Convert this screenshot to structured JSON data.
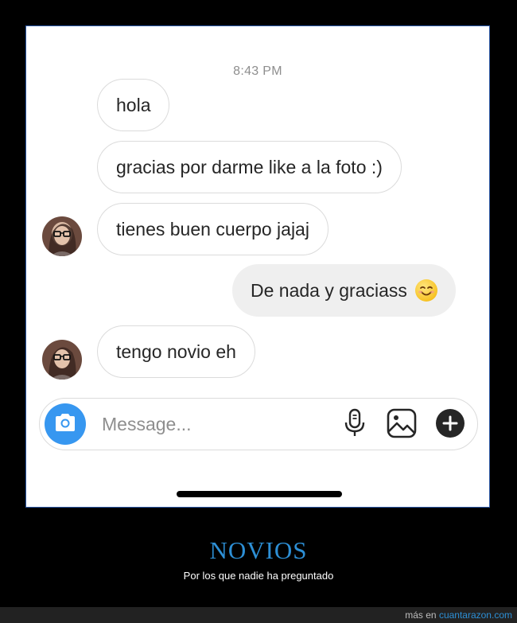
{
  "chat": {
    "timestamp": "8:43 PM",
    "messages": [
      {
        "text": "hola",
        "from": "other"
      },
      {
        "text": "gracias por darme like a la foto :)",
        "from": "other"
      },
      {
        "text": "tienes buen cuerpo jajaj",
        "from": "other"
      },
      {
        "text": "De nada y graciass",
        "from": "me",
        "emoji": "smiling-face-emoji"
      },
      {
        "text": "tengo novio eh",
        "from": "other"
      }
    ]
  },
  "composer": {
    "placeholder": "Message...",
    "icons": [
      "camera-icon",
      "microphone-icon",
      "gallery-icon",
      "plus-icon"
    ],
    "accent": "#3797f0"
  },
  "caption": {
    "title": "NOVIOS",
    "subtitle": "Por los que nadie ha preguntado",
    "color": "#2d8fd5"
  },
  "footer": {
    "prefix": "más en",
    "site": "cuantarazon.com"
  }
}
